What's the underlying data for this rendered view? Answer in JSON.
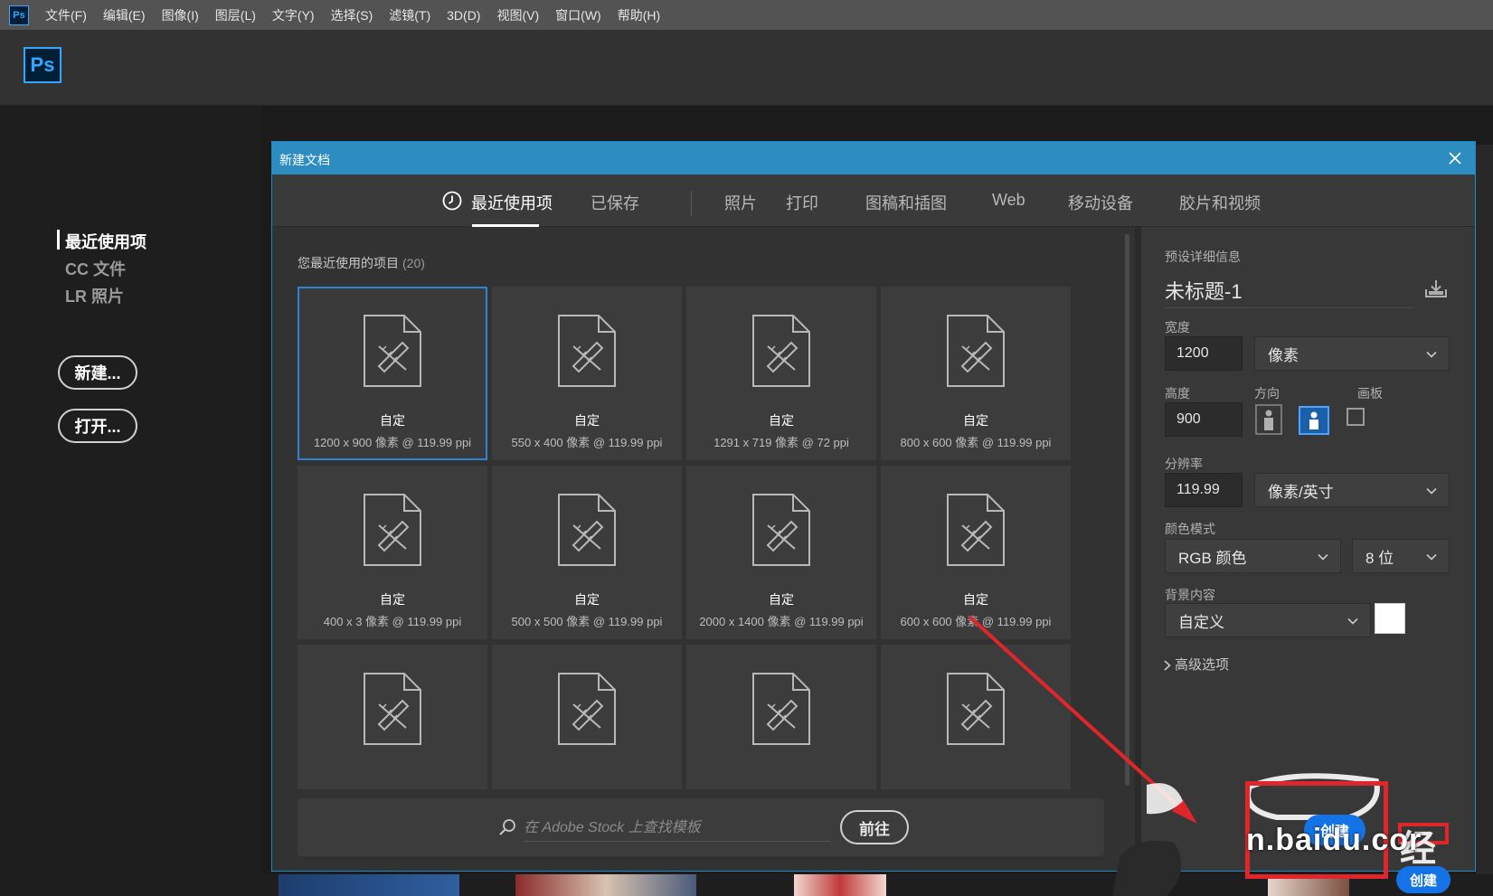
{
  "app": {
    "logo_small": "Ps",
    "logo_large": "Ps",
    "menu": [
      "文件(F)",
      "编辑(E)",
      "图像(I)",
      "图层(L)",
      "文字(Y)",
      "选择(S)",
      "滤镜(T)",
      "3D(D)",
      "视图(V)",
      "窗口(W)",
      "帮助(H)"
    ]
  },
  "start": {
    "nav": [
      "最近使用项",
      "CC 文件",
      "LR 照片"
    ],
    "new_button": "新建...",
    "open_button": "打开..."
  },
  "dialog": {
    "title": "新建文档",
    "tabs": [
      "最近使用项",
      "已保存",
      "照片",
      "打印",
      "图稿和插图",
      "Web",
      "移动设备",
      "胶片和视频"
    ],
    "recent_heading": "您最近使用的项目",
    "recent_count": "(20)",
    "presets": [
      {
        "name": "自定",
        "size": "1200 x 900 像素 @ 119.99 ppi",
        "selected": true
      },
      {
        "name": "自定",
        "size": "550 x 400 像素 @ 119.99 ppi"
      },
      {
        "name": "自定",
        "size": "1291 x 719 像素 @ 72 ppi"
      },
      {
        "name": "自定",
        "size": "800 x 600 像素 @ 119.99 ppi"
      },
      {
        "name": "自定",
        "size": "400 x 3 像素 @ 119.99 ppi"
      },
      {
        "name": "自定",
        "size": "500 x 500 像素 @ 119.99 ppi"
      },
      {
        "name": "自定",
        "size": "2000 x 1400 像素 @ 119.99 ppi"
      },
      {
        "name": "自定",
        "size": "600 x 600 像素 @ 119.99 ppi"
      },
      {
        "name": "",
        "size": ""
      },
      {
        "name": "",
        "size": ""
      },
      {
        "name": "",
        "size": ""
      },
      {
        "name": "",
        "size": ""
      }
    ],
    "stock_placeholder": "在 Adobe Stock 上查找模板",
    "go_button": "前往"
  },
  "details": {
    "heading": "预设详细信息",
    "doc_name": "未标题-1",
    "width_label": "宽度",
    "width_value": "1200",
    "width_unit": "像素",
    "height_label": "高度",
    "height_value": "900",
    "orientation_label": "方向",
    "artboard_label": "画板",
    "resolution_label": "分辨率",
    "resolution_value": "119.99",
    "resolution_unit": "像素/英寸",
    "color_mode_label": "颜色模式",
    "color_mode": "RGB 颜色",
    "bit_depth": "8 位",
    "background_label": "背景内容",
    "background": "自定义",
    "background_color": "#ffffff",
    "advanced": "高级选项"
  },
  "overlay": {
    "create_button": "创建",
    "create_button_2": "创建",
    "watermark": "n.baidu.cor"
  },
  "colors": {
    "accent": "#2d8dc0",
    "selection": "#2e83d6",
    "annotation": "#e0262a",
    "primary_button": "#1473e6"
  }
}
